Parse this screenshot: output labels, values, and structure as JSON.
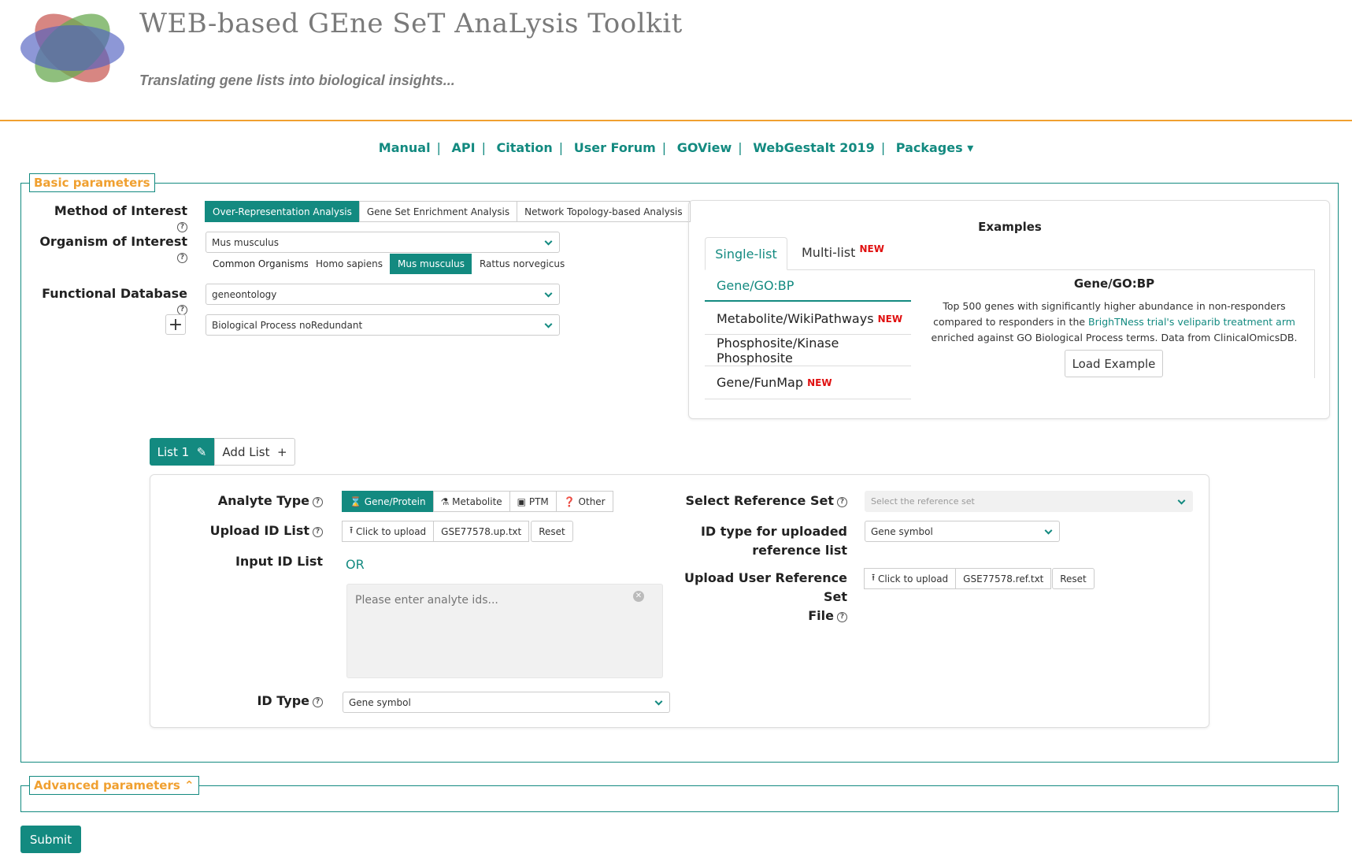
{
  "header": {
    "title": "WEB-based GEne SeT AnaLysis Toolkit",
    "tagline": "Translating gene lists into biological insights..."
  },
  "nav": {
    "items": [
      "Manual",
      "API",
      "Citation",
      "User Forum",
      "GOView",
      "WebGestalt 2019",
      "Packages ▾"
    ]
  },
  "basic": {
    "legend": "Basic parameters",
    "method_label": "Method of Interest",
    "methods": [
      "Over-Representation Analysis",
      "Gene Set Enrichment Analysis",
      "Network Topology-based Analysis"
    ],
    "organism_label": "Organism of Interest",
    "organism_value": "Mus musculus",
    "common_label": "Common Organisms:",
    "common_organisms": [
      "Homo sapiens",
      "Mus musculus",
      "Rattus norvegicus"
    ],
    "db_label": "Functional Database",
    "db_value": "geneontology",
    "db_sub_value": "Biological Process noRedundant",
    "plus": "+"
  },
  "examples": {
    "title": "Examples",
    "tabs": [
      "Single-list",
      "Multi-list"
    ],
    "new_badge": "NEW",
    "items": [
      "Gene/GO:BP",
      "Metabolite/WikiPathways",
      "Phosphosite/Kinase Phosphosite",
      "Gene/FunMap"
    ],
    "detail_title": "Gene/GO:BP",
    "detail_text_1": "Top 500 genes with significantly higher abundance in non-responders compared to responders in the ",
    "detail_link": "BrighTNess trial's veliparib treatment arm",
    "detail_text_2": " enriched against GO Biological Process terms. Data from ClinicalOmicsDB.",
    "load_button": "Load Example"
  },
  "lists": {
    "tab_active": "List 1",
    "tab_add": "Add List",
    "analyte_label": "Analyte Type",
    "analyte_types": [
      "Gene/Protein",
      "Metabolite",
      "PTM",
      "Other"
    ],
    "upload_label": "Upload ID List",
    "upload_button": "Click to upload",
    "upload_file": "GSE77578.up.txt",
    "reset": "Reset",
    "input_label": "Input ID List",
    "or": "OR",
    "textarea_placeholder": "Please enter analyte ids...",
    "idtype_label": "ID Type",
    "idtype_value": "Gene symbol",
    "ref_label": "Select Reference Set",
    "ref_placeholder": "Select the reference set",
    "ref_idtype_label_1": "ID type for uploaded",
    "ref_idtype_label_2": "reference list",
    "ref_idtype_value": "Gene symbol",
    "ref_upload_label_1": "Upload User Reference Set",
    "ref_upload_label_2": "File",
    "ref_upload_button": "Click to upload",
    "ref_upload_file": "GSE77578.ref.txt"
  },
  "advanced": {
    "legend": "Advanced parameters ⌃"
  },
  "submit": "Submit",
  "colors": {
    "accent": "#138a80",
    "legend": "#f0a030",
    "new": "#e01010"
  }
}
